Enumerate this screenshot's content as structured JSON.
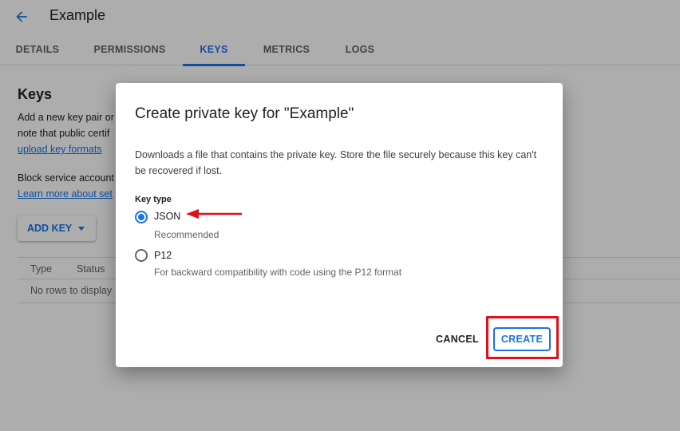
{
  "header": {
    "title": "Example",
    "back_icon": "arrow-back-icon"
  },
  "tabs": [
    {
      "label": "DETAILS",
      "active": false
    },
    {
      "label": "PERMISSIONS",
      "active": false
    },
    {
      "label": "KEYS",
      "active": true
    },
    {
      "label": "METRICS",
      "active": false
    },
    {
      "label": "LOGS",
      "active": false
    }
  ],
  "keys_section": {
    "heading": "Keys",
    "description_line1": "Add a new key pair or",
    "description_line2": "note that public certif",
    "upload_link": "upload key formats",
    "block_text": "Block service account",
    "learn_link": "Learn more about set",
    "add_key_label": "ADD KEY",
    "table_headers": [
      "Type",
      "Status"
    ],
    "empty_text": "No rows to display"
  },
  "dialog": {
    "title": "Create private key for \"Example\"",
    "description": "Downloads a file that contains the private key. Store the file securely because this key can't be recovered if lost.",
    "key_type_label": "Key type",
    "options": [
      {
        "label": "JSON",
        "sublabel": "Recommended",
        "selected": true
      },
      {
        "label": "P12",
        "sublabel": "For backward compatibility with code using the P12 format",
        "selected": false
      }
    ],
    "cancel_label": "CANCEL",
    "create_label": "CREATE"
  },
  "colors": {
    "accent": "#1a73e8",
    "annotation": "#e0101a",
    "scrim": "rgba(0,0,0,0.32)"
  }
}
